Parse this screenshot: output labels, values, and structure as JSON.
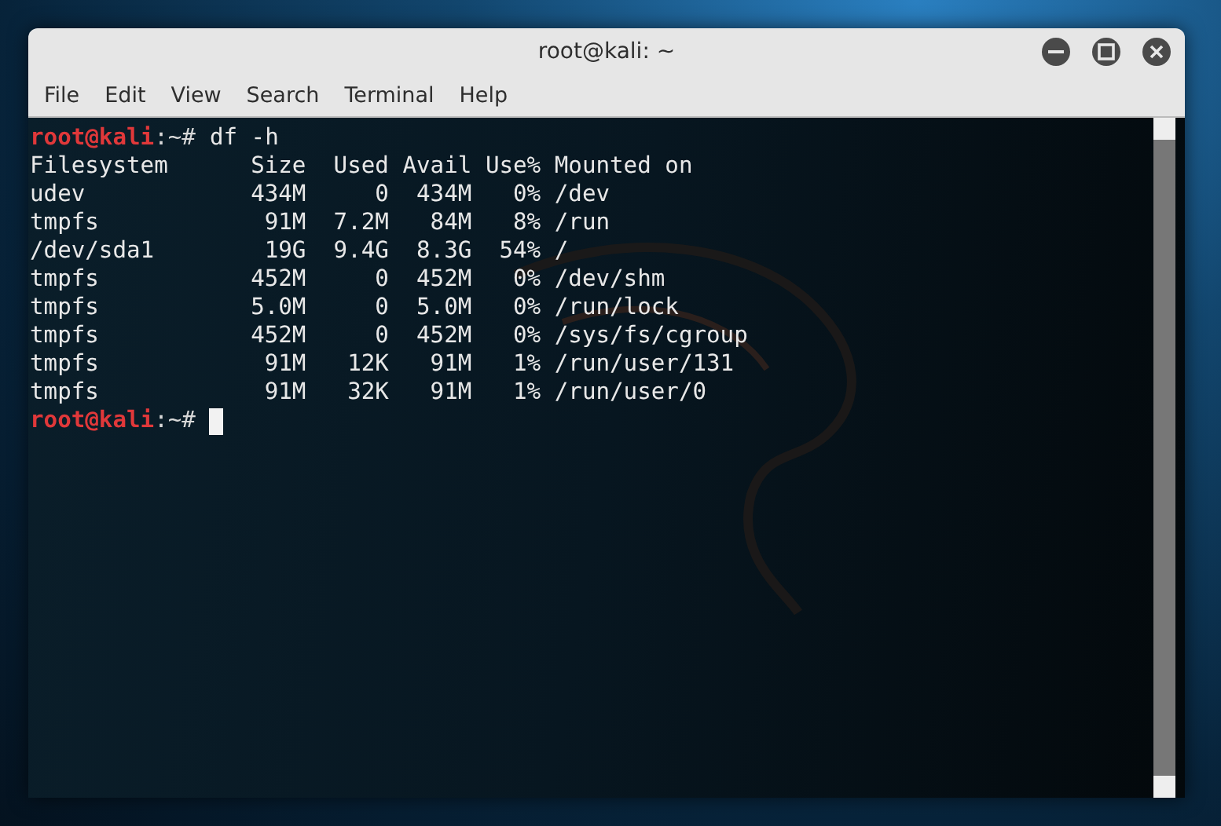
{
  "window": {
    "title": "root@kali: ~"
  },
  "menu": [
    "File",
    "Edit",
    "View",
    "Search",
    "Terminal",
    "Help"
  ],
  "terminal": {
    "lines": [
      {
        "kind": "prompt",
        "user_host": "root@kali",
        "path": ":~#",
        "command": "df -h",
        "cursor": false
      },
      {
        "kind": "output",
        "text": "Filesystem      Size  Used Avail Use% Mounted on"
      },
      {
        "kind": "output",
        "text": "udev            434M     0  434M   0% /dev"
      },
      {
        "kind": "output",
        "text": "tmpfs            91M  7.2M   84M   8% /run"
      },
      {
        "kind": "output",
        "text": "/dev/sda1        19G  9.4G  8.3G  54% /"
      },
      {
        "kind": "output",
        "text": "tmpfs           452M     0  452M   0% /dev/shm"
      },
      {
        "kind": "output",
        "text": "tmpfs           5.0M     0  5.0M   0% /run/lock"
      },
      {
        "kind": "output",
        "text": "tmpfs           452M     0  452M   0% /sys/fs/cgroup"
      },
      {
        "kind": "output",
        "text": "tmpfs            91M   12K   91M   1% /run/user/131"
      },
      {
        "kind": "output",
        "text": "tmpfs            91M   32K   91M   1% /run/user/0"
      },
      {
        "kind": "prompt",
        "user_host": "root@kali",
        "path": ":~#",
        "cursor": true
      }
    ]
  }
}
